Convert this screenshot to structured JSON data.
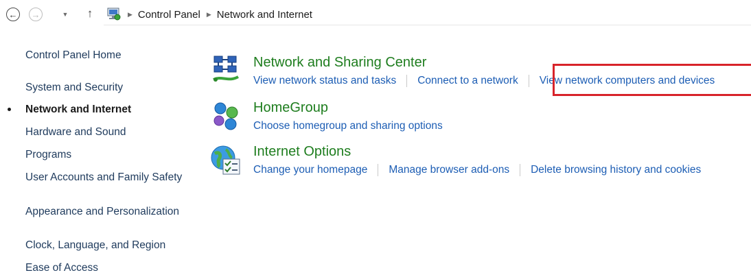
{
  "navigation": {
    "back_icon": "back-arrow-icon",
    "forward_icon": "forward-arrow-icon",
    "recent_icon": "chevron-down-icon",
    "up_icon": "up-arrow-icon"
  },
  "address_bar": {
    "icon": "control-panel-icon",
    "breadcrumbs": [
      "Control Panel",
      "Network and Internet"
    ]
  },
  "sidebar": {
    "items": [
      {
        "label": "Control Panel Home"
      },
      {
        "label": "System and Security"
      },
      {
        "label": "Network and Internet",
        "active": true
      },
      {
        "label": "Hardware and Sound"
      },
      {
        "label": "Programs"
      },
      {
        "label": "User Accounts and Family Safety"
      },
      {
        "label": "Appearance and Personalization"
      },
      {
        "label": "Clock, Language, and Region"
      },
      {
        "label": "Ease of Access"
      }
    ]
  },
  "categories": [
    {
      "title": "Network and Sharing Center",
      "icon": "network-sharing-icon",
      "links": [
        "View network status and tasks",
        "Connect to a network",
        "View network computers and devices"
      ]
    },
    {
      "title": "HomeGroup",
      "icon": "homegroup-icon",
      "links": [
        "Choose homegroup and sharing options"
      ]
    },
    {
      "title": "Internet Options",
      "icon": "internet-options-icon",
      "links": [
        "Change your homepage",
        "Manage browser add-ons",
        "Delete browsing history and cookies"
      ]
    }
  ],
  "colors": {
    "category_title": "#1e7d1e",
    "link": "#1c5db4",
    "highlight_box": "#d8232a"
  }
}
